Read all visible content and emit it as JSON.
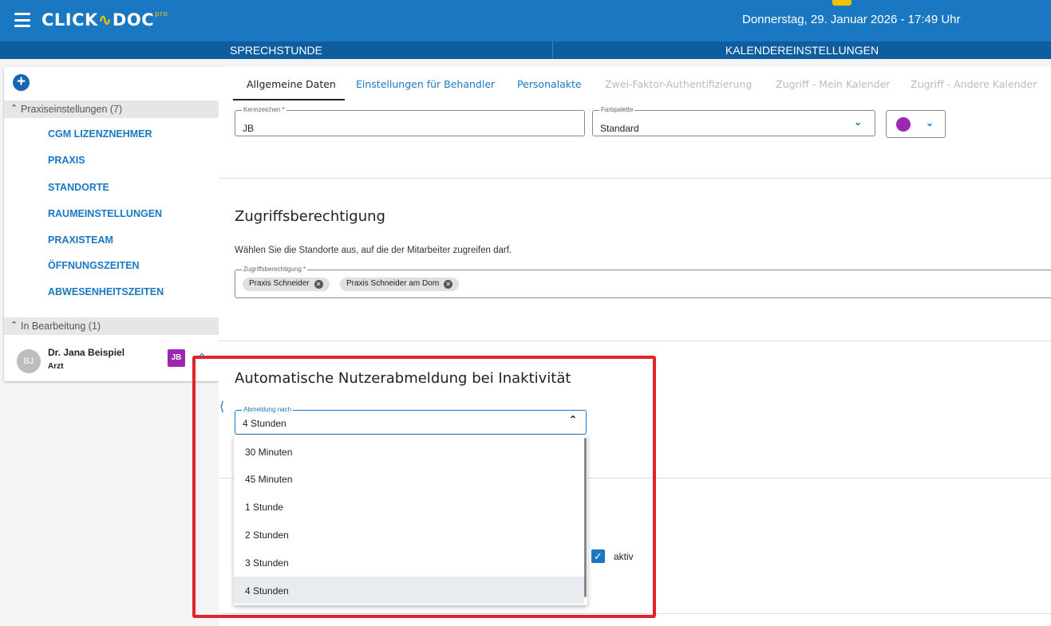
{
  "app": {
    "logo_text": "CLICK",
    "logo_pulse": "∿",
    "logo_text2": "DOC",
    "logo_sup": "pro",
    "datetime": "Donnerstag, 29. Januar 2026 - 17:49 Uhr"
  },
  "nav": {
    "left": "SPRECHSTUNDE",
    "right": "KALENDEREINSTELLUNGEN"
  },
  "sidebar": {
    "add_label": "+",
    "section1": "Praxiseinstellungen (7)",
    "items": [
      "CGM LIZENZNEHMER",
      "PRAXIS",
      "STANDORTE",
      "RAUMEINSTELLUNGEN",
      "PRAXISTEAM",
      "ÖFFNUNGSZEITEN",
      "ABWESENHEITSZEITEN"
    ],
    "section2": "In Bearbeitung (1)",
    "person": {
      "initials": "BJ",
      "name": "Dr. Jana Beispiel",
      "role": "Arzt",
      "badge": "JB"
    }
  },
  "tabs": [
    {
      "label": "Allgemeine Daten",
      "state": "active"
    },
    {
      "label": "Einstellungen für Behandler",
      "state": "link"
    },
    {
      "label": "Personalakte",
      "state": "link"
    },
    {
      "label": "Zwei-Faktor-Authentifizierung",
      "state": "disabled"
    },
    {
      "label": "Zugriff - Mein Kalender",
      "state": "disabled"
    },
    {
      "label": "Zugriff - Andere Kalender",
      "state": "disabled"
    }
  ],
  "form": {
    "kennzeichen_label": "Kennzeichen",
    "kennzeichen_req": "*",
    "kennzeichen_value": "JB",
    "farbpalette_label": "Farbpalette",
    "farbpalette_value": "Standard",
    "color_value": "#9c27b0"
  },
  "access": {
    "title": "Zugriffsberechtigung",
    "description": "Wählen Sie die Standorte aus, auf die der Mitarbeiter zugreifen darf.",
    "field_label": "Zugriffsberechtigung",
    "field_req": "*",
    "chips": [
      "Praxis Schneider",
      "Praxis Schneider am Dom"
    ]
  },
  "logout": {
    "title": "Automatische Nutzerabmeldung bei Inaktivität",
    "field_label": "Abmeldung nach",
    "value": "4 Stunden",
    "options": [
      "30 Minuten",
      "45 Minuten",
      "1 Stunde",
      "2 Stunden",
      "3 Stunden",
      "4 Stunden"
    ],
    "selected": "4 Stunden"
  },
  "active_checkbox": {
    "label": "aktiv",
    "checked": true
  },
  "colors": {
    "primary": "#1a78c2",
    "nav_dark": "#0e5d9e",
    "badge": "#9c27b0",
    "highlight": "#e0242c",
    "accent": "#f2c300"
  }
}
